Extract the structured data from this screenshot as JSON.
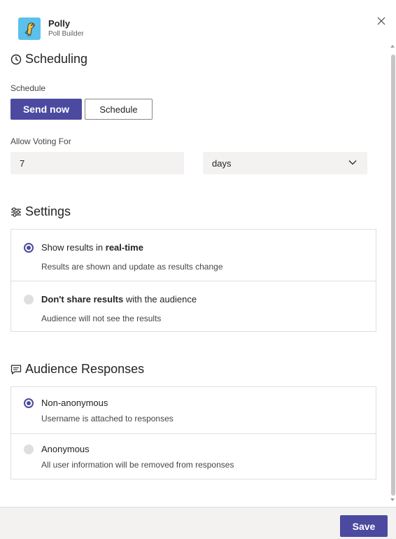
{
  "app": {
    "name": "Polly",
    "subtitle": "Poll Builder",
    "logo_icon": "polly-parrot-icon"
  },
  "scheduling": {
    "title": "Scheduling",
    "schedule_label": "Schedule",
    "send_now_label": "Send now",
    "schedule_button_label": "Schedule",
    "allow_voting_label": "Allow Voting For",
    "voting_value": "7",
    "voting_unit": "days"
  },
  "settings": {
    "title": "Settings",
    "options": [
      {
        "title_prefix": "Show results in ",
        "title_bold": "real-time",
        "title_suffix": "",
        "description": "Results are shown and update as results change",
        "selected": true
      },
      {
        "title_prefix": "",
        "title_bold": "Don't share results",
        "title_suffix": " with the audience",
        "description": "Audience will not see the results",
        "selected": false
      }
    ]
  },
  "audience": {
    "title": "Audience Responses",
    "options": [
      {
        "title": "Non-anonymous",
        "description": "Username is attached to responses",
        "selected": true
      },
      {
        "title": "Anonymous",
        "description": "All user information will be removed from responses",
        "selected": false
      }
    ]
  },
  "footer": {
    "save_label": "Save"
  },
  "colors": {
    "accent": "#4b4aa0",
    "footer_bg": "#f3f2f1",
    "input_bg": "#f3f2f1",
    "logo_bg": "#5bc0eb"
  }
}
